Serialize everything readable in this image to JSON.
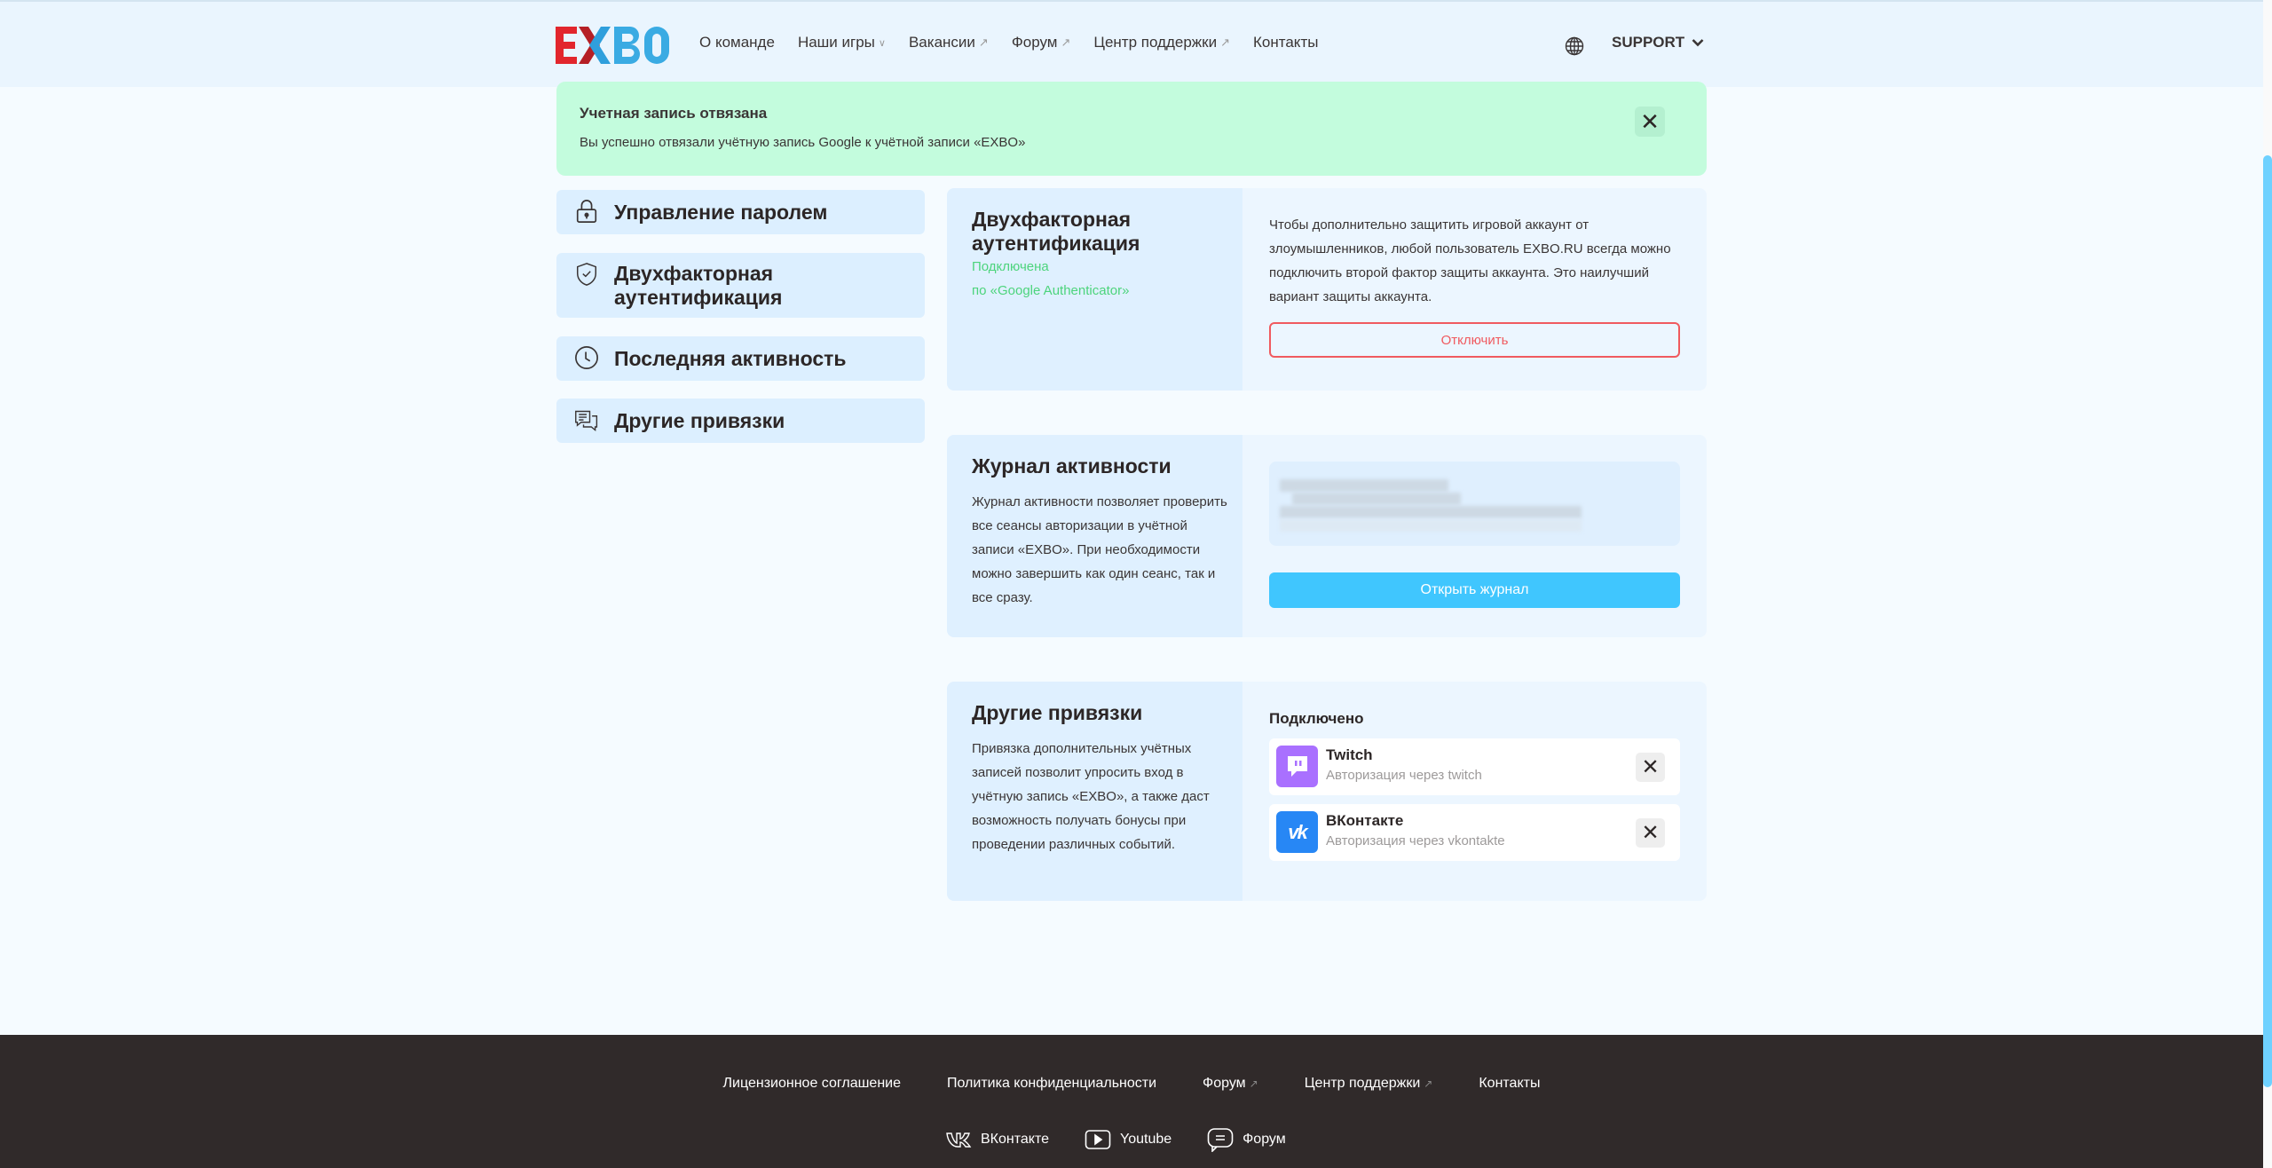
{
  "header": {
    "logo_text": "EXBO",
    "nav": [
      {
        "label": "О команде",
        "marker": ""
      },
      {
        "label": "Наши игры",
        "marker": "chevron"
      },
      {
        "label": "Вакансии",
        "marker": "external"
      },
      {
        "label": "Форум",
        "marker": "external"
      },
      {
        "label": "Центр поддержки",
        "marker": "external"
      },
      {
        "label": "Контакты",
        "marker": ""
      }
    ],
    "language_icon": "globe-icon",
    "user_menu": "SUPPORT"
  },
  "alert": {
    "title": "Учетная запись отвязана",
    "text": "Вы успешно отвязали учётную запись Google к учётной записи «EXBO»",
    "close_icon": "close-icon"
  },
  "sidebar": {
    "items": [
      {
        "label": "Управление паролем",
        "icon": "lock-icon"
      },
      {
        "label": "Двухфакторная аутентификация",
        "icon": "shield-check-icon"
      },
      {
        "label": "Последняя активность",
        "icon": "clock-icon"
      },
      {
        "label": "Другие привязки",
        "icon": "chat-icon"
      }
    ]
  },
  "two_factor": {
    "title": "Двухфакторная аутентификация",
    "status": "Подключена",
    "method": "по «Google Authenticator»",
    "description": "Чтобы дополнительно защитить игровой аккаунт от злоумышленников, любой пользователь EXBO.RU всегда можно подключить второй фактор защиты аккаунта. Это наилучший вариант защиты аккаунта.",
    "disable_button": "Отключить"
  },
  "activity_log": {
    "title": "Журнал активности",
    "description": "Журнал активности позволяет проверить все сеансы авторизации в учётной записи «EXBO». При необходимости можно завершить как один сеанс, так и все сразу.",
    "open_button": "Открыть журнал"
  },
  "other_links": {
    "title": "Другие привязки",
    "description": "Привязка дополнительных учётных записей позволит упросить вход в учётную запись «EXBO», а также даст возможность получать бонусы при проведении различных событий.",
    "connected_title": "Подключено",
    "items": [
      {
        "name": "Twitch",
        "subtitle": "Авторизация через twitch",
        "icon": "twitch-icon",
        "color": "#a970ff"
      },
      {
        "name": "ВКонтакте",
        "subtitle": "Авторизация через vkontakte",
        "icon": "vk-icon",
        "color": "#2787f5"
      }
    ]
  },
  "footer": {
    "links": [
      {
        "label": "Лицензионное соглашение",
        "external": false
      },
      {
        "label": "Политика конфиденциальности",
        "external": false
      },
      {
        "label": "Форум",
        "external": true
      },
      {
        "label": "Центр поддержки",
        "external": true
      },
      {
        "label": "Контакты",
        "external": false
      }
    ],
    "social": [
      {
        "label": "ВКонтакте",
        "icon": "vk-icon"
      },
      {
        "label": "Youtube",
        "icon": "youtube-icon"
      },
      {
        "label": "Форум",
        "icon": "forum-icon"
      }
    ]
  },
  "colors": {
    "accent_blue": "#40c6fe",
    "danger": "#f05a5f",
    "success": "#4cd47c",
    "alert_bg": "#c3fcdd",
    "footer_bg": "#302a2a"
  }
}
